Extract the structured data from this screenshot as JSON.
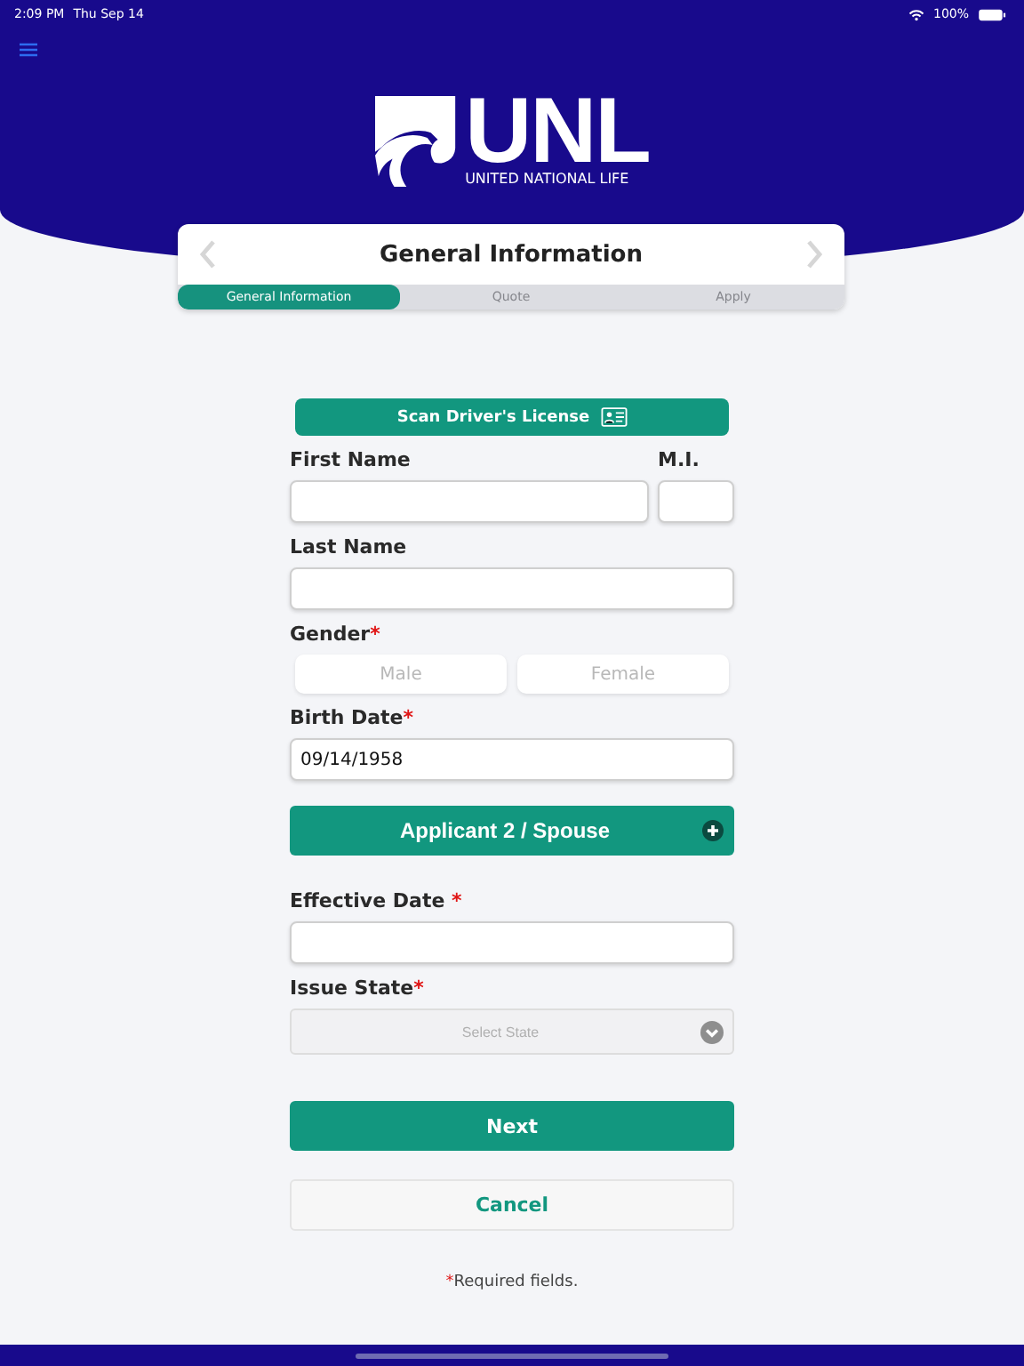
{
  "status_bar": {
    "time": "2:09 PM",
    "date": "Thu Sep 14",
    "battery": "100%"
  },
  "logo": {
    "wordmark": "UNL",
    "tagline": "UNITED NATIONAL LIFE"
  },
  "wizard": {
    "title": "General Information",
    "steps": [
      {
        "label": "General Information",
        "selected": true
      },
      {
        "label": "Quote",
        "selected": false
      },
      {
        "label": "Apply",
        "selected": false
      }
    ]
  },
  "scan_button": "Scan Driver's License",
  "first_name": {
    "label": "First Name"
  },
  "middle_initial": {
    "label": "M.I."
  },
  "last_name": {
    "label": "Last Name"
  },
  "gender": {
    "label": "Gender",
    "required_mark": "*",
    "options": [
      {
        "label": "Male",
        "selected": false
      },
      {
        "label": "Female",
        "selected": false
      }
    ]
  },
  "birth_date": {
    "label": "Birth Date",
    "required_mark": "*",
    "value": "09/14/1958"
  },
  "applicant2_button": "Applicant 2 / Spouse",
  "effective_date": {
    "label": "Effective Date",
    "required_mark": "*"
  },
  "issue_state": {
    "label": "Issue State",
    "required_mark": "*",
    "placeholder": "Select State"
  },
  "next_button": "Next",
  "cancel_button": "Cancel",
  "footnote": {
    "mark": "*",
    "text": "Required fields."
  }
}
